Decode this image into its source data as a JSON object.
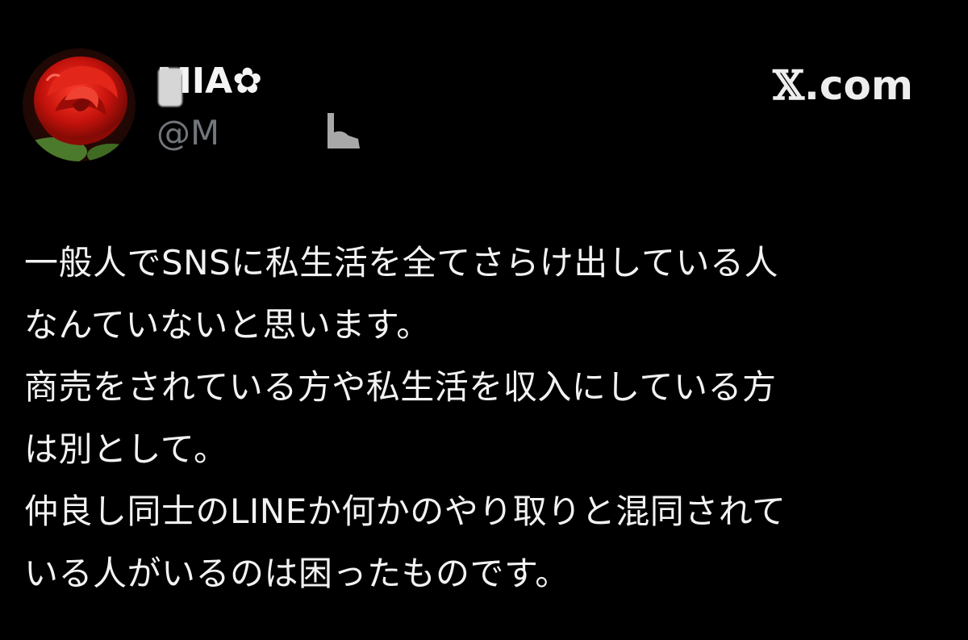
{
  "tweet": {
    "author": {
      "display_name": "MIA✿",
      "handle": "@M",
      "avatar": "red-rose-avatar"
    },
    "brand": {
      "mark": "𝕏",
      "domain": ".com"
    },
    "text_lines": [
      "一般人でSNSに私生活を全てさらけ出している人",
      "なんていないと思います。",
      "商売をされている方や私生活を収入にしている方",
      "は別として。",
      "仲良し同士のLINEか何かのやり取りと混同されて",
      "いる人がいるのは困ったものです。"
    ]
  },
  "colors": {
    "background": "#000000",
    "text": "#f2f2f2",
    "secondary_text": "#71767b",
    "rose": "#c4120c"
  }
}
